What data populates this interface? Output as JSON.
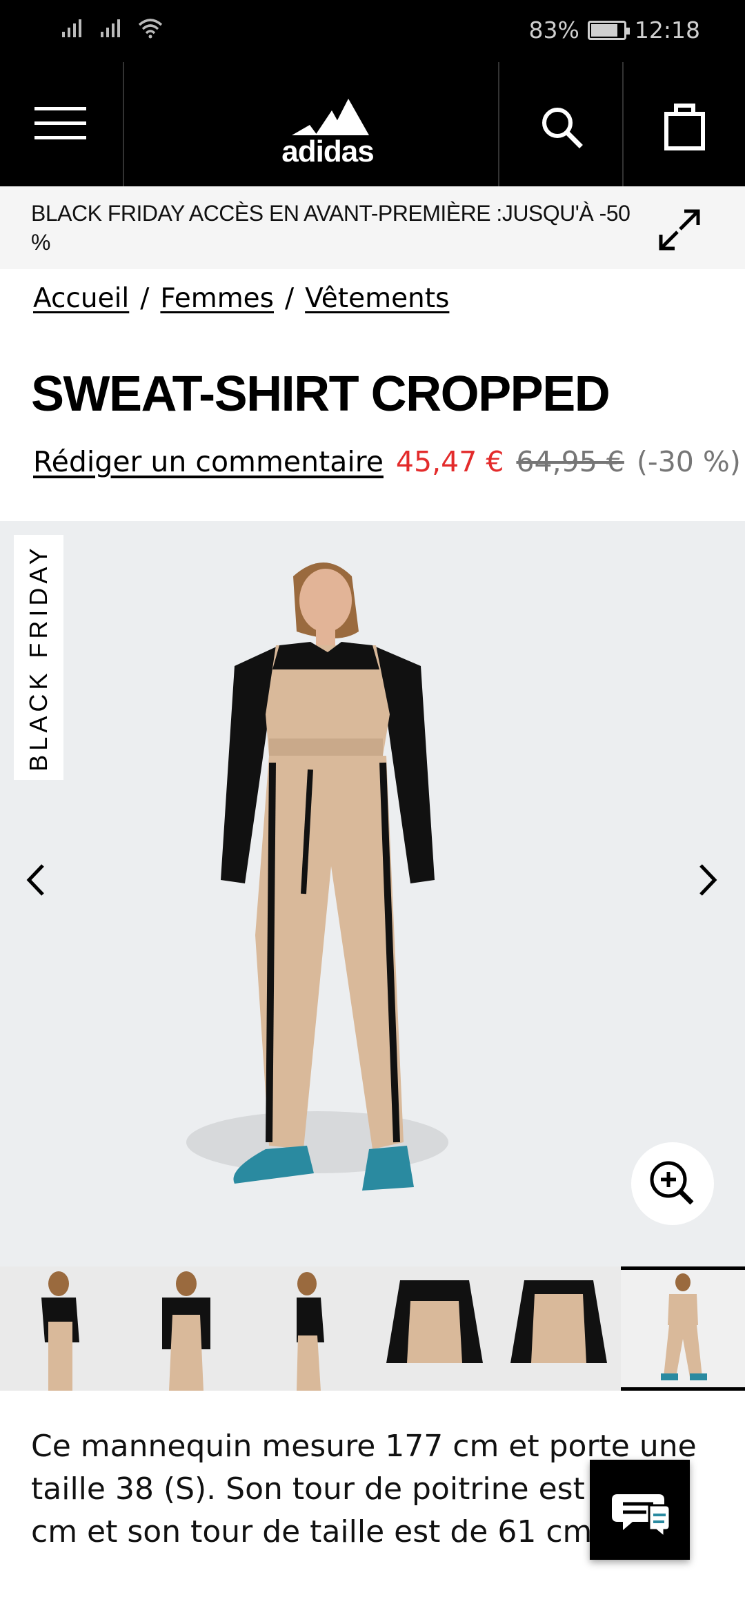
{
  "status_bar": {
    "battery": "83%",
    "battery_level": 0.83,
    "time": "12:18"
  },
  "header": {
    "logo_text": "adidas"
  },
  "promo": {
    "text": "BLACK FRIDAY ACCÈS EN AVANT-PREMIÈRE :JUSQU'À -50 %"
  },
  "breadcrumb": [
    {
      "label": "Accueil"
    },
    {
      "label": "Femmes"
    },
    {
      "label": "Vêtements"
    }
  ],
  "breadcrumb_separator": "/",
  "product": {
    "title": "SWEAT-SHIRT CROPPED",
    "review_link": "Rédiger un commentaire",
    "price_sale": "45,47 €",
    "price_original": "64,95 €",
    "discount": "(-30 %)"
  },
  "gallery": {
    "badge": "BLACK FRIDAY",
    "thumbnail_count": 6,
    "active_thumbnail": 6
  },
  "description": "Ce mannequin mesure 177 cm et porte une taille 38 (S). Son tour de poitrine est de 86 cm et son tour de taille est de 61 cm.",
  "colors": {
    "sale": "#e32b2b",
    "muted": "#767676",
    "header_bg": "#000000",
    "garment_beige": "#d9b99a"
  }
}
